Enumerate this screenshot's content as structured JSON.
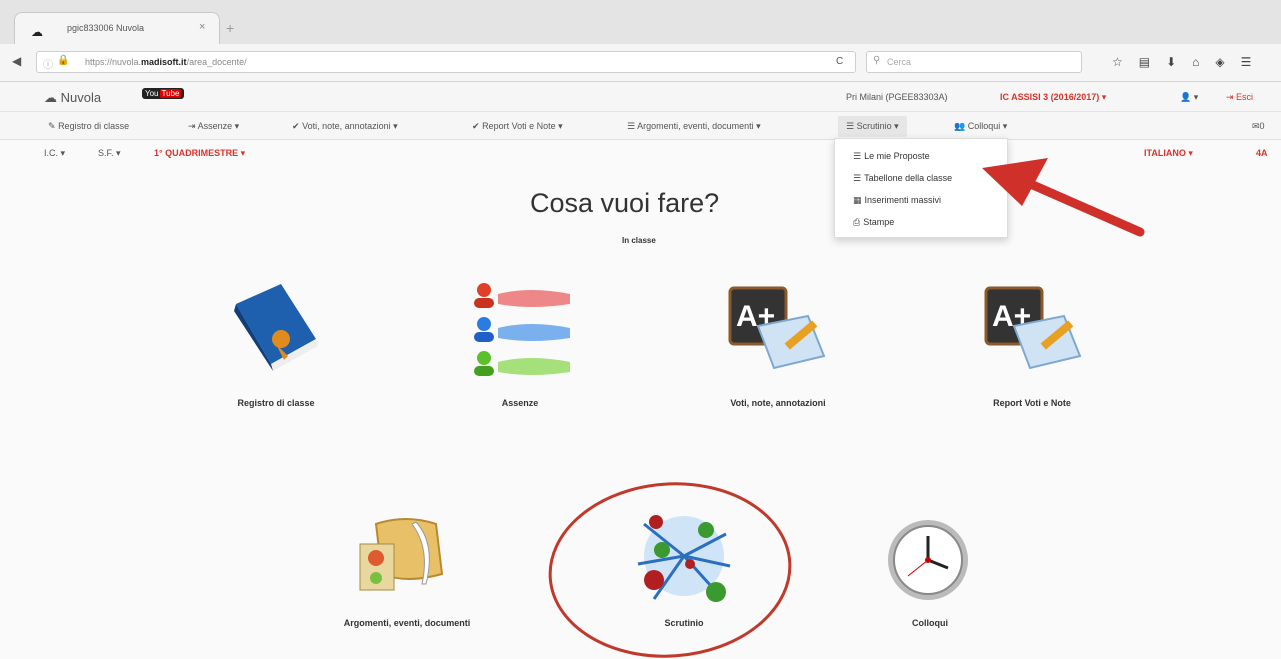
{
  "browser": {
    "tab_title": "pgic833006 Nuvola",
    "tab_close": "×",
    "new_tab": "+",
    "url_prefix": "https://nuvola.",
    "url_domain": "madisoft.it",
    "url_path": "/area_docente/",
    "search_placeholder": "Cerca",
    "reload": "C"
  },
  "app": {
    "logo": "Nuvola",
    "youtube_you": "You",
    "youtube_tube": "Tube",
    "school": "Pri Milani (PGEE83303A)",
    "institution": "IC ASSISI 3 (2016/2017) ▾",
    "user_menu": "▾",
    "logout": "Esci"
  },
  "menu": {
    "items": [
      {
        "label": "Registro di classe"
      },
      {
        "label": "Assenze ▾"
      },
      {
        "label": "Voti, note, annotazioni ▾"
      },
      {
        "label": "Report Voti e Note ▾"
      },
      {
        "label": "Argomenti, eventi, documenti ▾"
      },
      {
        "label": "Scrutinio ▾"
      },
      {
        "label": "Colloqui ▾"
      }
    ],
    "messages": "0"
  },
  "subbar": {
    "ic": "I.C. ▾",
    "sf": "S.F. ▾",
    "period": "1° QUADRIMESTRE ▾",
    "subject": "ITALIANO ▾",
    "class": "4A"
  },
  "main": {
    "title": "Cosa vuoi fare?",
    "subtitle": "In classe",
    "tiles": [
      {
        "label": "Registro di classe",
        "icon": "register-book-icon"
      },
      {
        "label": "Assenze",
        "icon": "absences-icon"
      },
      {
        "label": "Voti, note, annotazioni",
        "icon": "grades-icon"
      },
      {
        "label": "Report Voti e Note",
        "icon": "grades-report-icon"
      },
      {
        "label": "Argomenti, eventi, documenti",
        "icon": "documents-icon"
      },
      {
        "label": "Scrutinio",
        "icon": "scrutinio-icon"
      },
      {
        "label": "Colloqui",
        "icon": "clock-icon"
      }
    ]
  },
  "dropdown": {
    "items": [
      {
        "label": "Le mie Proposte"
      },
      {
        "label": "Tabellone della classe"
      },
      {
        "label": "Inserimenti massivi"
      },
      {
        "label": "Stampe"
      }
    ]
  },
  "colors": {
    "accent_red": "#d9322a",
    "annotation_red": "#c0392b"
  }
}
